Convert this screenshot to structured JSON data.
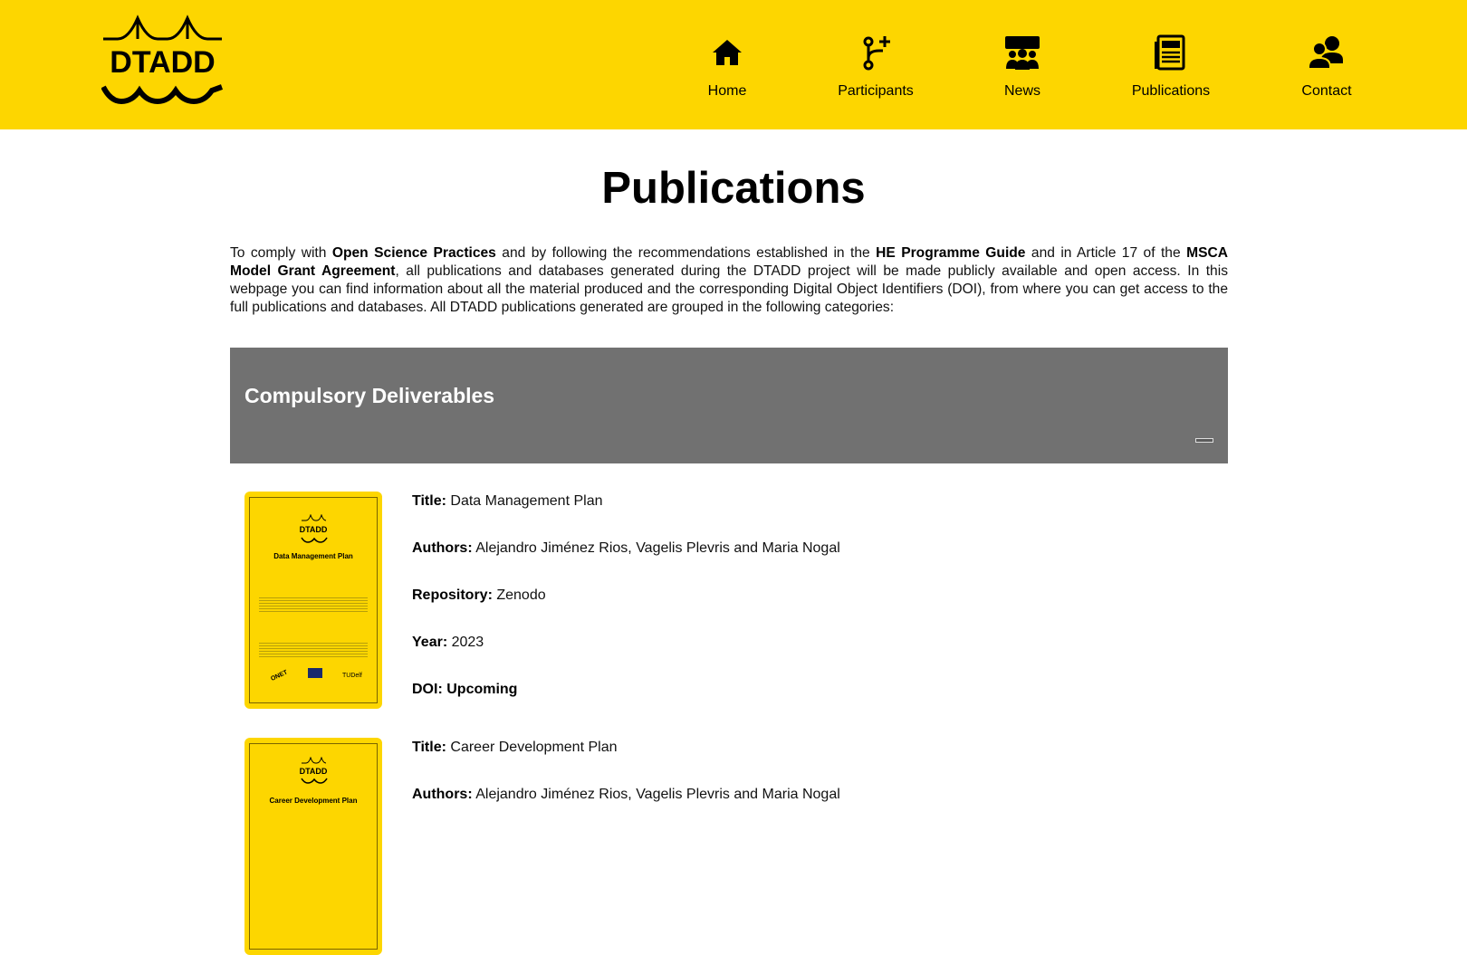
{
  "brand": {
    "name": "DTADD"
  },
  "nav": [
    {
      "label": "Home",
      "icon": "home-icon"
    },
    {
      "label": "Participants",
      "icon": "branch-plus-icon"
    },
    {
      "label": "News",
      "icon": "people-group-icon"
    },
    {
      "label": "Publications",
      "icon": "newspaper-icon"
    },
    {
      "label": "Contact",
      "icon": "chat-people-icon"
    }
  ],
  "page": {
    "title": "Publications",
    "intro": {
      "p1": "To comply with ",
      "b1": "Open Science Practices",
      "p2": " and by following the recommendations established in the ",
      "b2": "HE Programme Guide",
      "p3": " and in Article 17 of the ",
      "b3": "MSCA Model Grant Agreement",
      "p4": ", all publications and databases generated during the DTADD project will be made publicly available and open access. In this webpage you can find information about all the material produced and the corresponding Digital Object Identifiers (DOI), from where you can get access to the full publications and databases. All DTADD publications generated are grouped in the following categories:"
    }
  },
  "section": {
    "title": "Compulsory Deliverables"
  },
  "labels": {
    "title": "Title:",
    "authors": "Authors:",
    "repository": "Repository:",
    "year": "Year:",
    "doi": "DOI:"
  },
  "publications": [
    {
      "title": "Data Management Plan",
      "authors": "Alejandro Jiménez Rios, Vagelis Plevris and Maria Nogal",
      "repository": "Zenodo",
      "year": "2023",
      "doi": "Upcoming",
      "cover_title": "Data Management Plan"
    },
    {
      "title": "Career Development Plan",
      "authors": "Alejandro Jiménez Rios, Vagelis Plevris and Maria Nogal",
      "cover_title": "Career Development Plan"
    }
  ],
  "colors": {
    "brand_yellow": "#FDD600",
    "panel_gray": "#717171"
  }
}
